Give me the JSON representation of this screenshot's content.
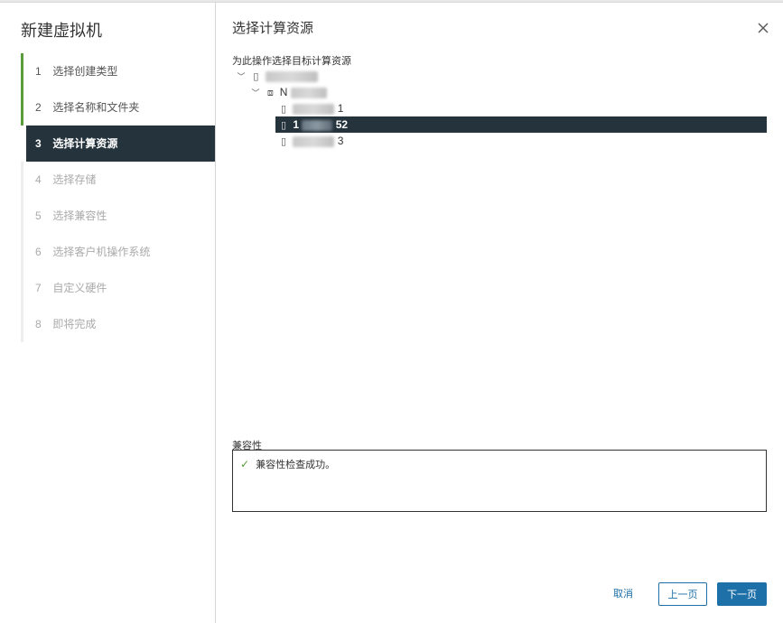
{
  "wizard": {
    "title": "新建虚拟机",
    "steps": [
      {
        "num": "1",
        "label": "选择创建类型",
        "state": "done"
      },
      {
        "num": "2",
        "label": "选择名称和文件夹",
        "state": "done"
      },
      {
        "num": "3",
        "label": "选择计算资源",
        "state": "active"
      },
      {
        "num": "4",
        "label": "选择存储",
        "state": "future"
      },
      {
        "num": "5",
        "label": "选择兼容性",
        "state": "future"
      },
      {
        "num": "6",
        "label": "选择客户机操作系统",
        "state": "future"
      },
      {
        "num": "7",
        "label": "自定义硬件",
        "state": "future"
      },
      {
        "num": "8",
        "label": "即将完成",
        "state": "future"
      }
    ]
  },
  "content": {
    "title": "选择计算资源",
    "tree_label": "为此操作选择目标计算资源",
    "tree": {
      "datacenter_suffix": "",
      "cluster_prefix": "N",
      "hosts": [
        {
          "suffix": "1",
          "selected": false
        },
        {
          "prefix": "1",
          "suffix": "52",
          "selected": true
        },
        {
          "suffix": "3",
          "selected": false
        }
      ]
    },
    "compat_label": "兼容性",
    "compat_message": "兼容性检查成功。"
  },
  "buttons": {
    "cancel": "取消",
    "prev": "上一页",
    "next": "下一页"
  },
  "colors": {
    "active_step_bg": "#25333d",
    "done_step_bar": "#5a9b3a",
    "primary": "#1d70a8"
  }
}
